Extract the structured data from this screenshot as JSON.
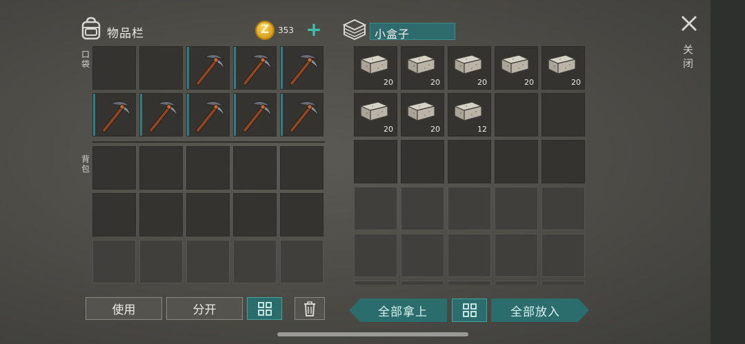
{
  "inventory": {
    "title": "物品栏",
    "coins": "353",
    "pocket_label": "口袋",
    "backpack_label": "背包",
    "pocket_slots": [
      {
        "item": null
      },
      {
        "item": null
      },
      {
        "item": "pickaxe"
      },
      {
        "item": "pickaxe"
      },
      {
        "item": "pickaxe"
      },
      {
        "item": "pickaxe"
      },
      {
        "item": "pickaxe"
      },
      {
        "item": "pickaxe"
      },
      {
        "item": "pickaxe"
      },
      {
        "item": "pickaxe"
      }
    ],
    "backpack_rows": 3
  },
  "container": {
    "name": "小盒子",
    "slots": [
      {
        "item": "stone-block",
        "count": "20"
      },
      {
        "item": "stone-block",
        "count": "20"
      },
      {
        "item": "stone-block",
        "count": "20"
      },
      {
        "item": "stone-block",
        "count": "20"
      },
      {
        "item": "stone-block",
        "count": "20"
      },
      {
        "item": "stone-block",
        "count": "20"
      },
      {
        "item": "stone-block",
        "count": "20"
      },
      {
        "item": "stone-block",
        "count": "12"
      }
    ]
  },
  "close_label": "关闭",
  "buttons": {
    "use": "使用",
    "split": "分开",
    "take_all": "全部拿上",
    "put_all": "全部放入"
  },
  "colors": {
    "accent": "#2b6d6c",
    "plus": "#3ec0b0",
    "coin": "#e2aa22"
  }
}
